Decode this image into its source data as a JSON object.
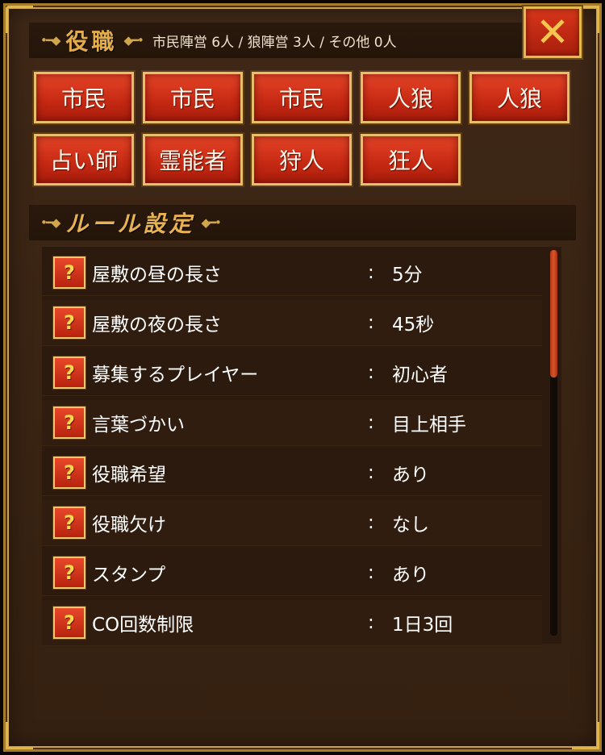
{
  "roles_section": {
    "title": "役職",
    "summary": "市民陣営 6人 / 狼陣営 3人 / その他 0人",
    "roles": [
      "市民",
      "市民",
      "市民",
      "人狼",
      "人狼",
      "占い師",
      "霊能者",
      "狩人",
      "狂人"
    ]
  },
  "rules_section": {
    "title": "ルール設定",
    "rows": [
      {
        "label": "屋敷の昼の長さ",
        "value": "5分"
      },
      {
        "label": "屋敷の夜の長さ",
        "value": "45秒"
      },
      {
        "label": "募集するプレイヤー",
        "value": "初心者"
      },
      {
        "label": "言葉づかい",
        "value": "目上相手"
      },
      {
        "label": "役職希望",
        "value": "あり"
      },
      {
        "label": "役職欠け",
        "value": "なし"
      },
      {
        "label": "スタンプ",
        "value": "あり"
      },
      {
        "label": "CO回数制限",
        "value": "1日3回"
      }
    ],
    "separator": ":",
    "help_glyph": "?"
  },
  "close_button": {
    "glyph": "✕"
  },
  "scroll_position": 0.0,
  "colors": {
    "panel": "#3a2414",
    "gold": "#e3ad4e",
    "button_red": "#c82a14"
  },
  "icons": {
    "ornament": "ornament-icon",
    "help": "help-icon",
    "close": "close-icon"
  }
}
